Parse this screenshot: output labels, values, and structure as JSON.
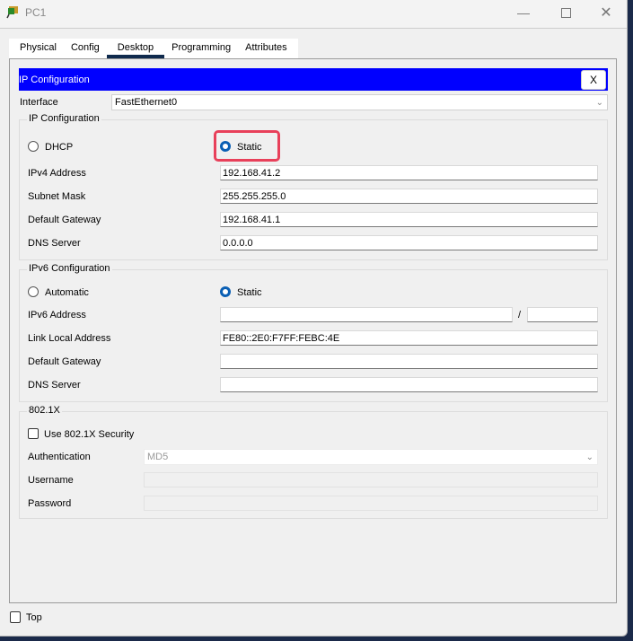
{
  "window": {
    "title": "PC1",
    "icon": "packet-tracer-pc-icon",
    "controls": [
      "minimize-icon",
      "maximize-icon",
      "close-icon"
    ]
  },
  "tabs": [
    {
      "label": "Physical",
      "active": false
    },
    {
      "label": "Config",
      "active": false
    },
    {
      "label": "Desktop",
      "active": true
    },
    {
      "label": "Programming",
      "active": false
    },
    {
      "label": "Attributes",
      "active": false
    }
  ],
  "ip_config": {
    "header": "IP Configuration",
    "close_label": "X",
    "interface_label": "Interface",
    "interface_value": "FastEthernet0",
    "ipv4": {
      "legend": "IP Configuration",
      "dhcp_label": "DHCP",
      "static_label": "Static",
      "selected": "Static",
      "fields": [
        {
          "label": "IPv4 Address",
          "value": "192.168.41.2"
        },
        {
          "label": "Subnet Mask",
          "value": "255.255.255.0"
        },
        {
          "label": "Default Gateway",
          "value": "192.168.41.1"
        },
        {
          "label": "DNS Server",
          "value": "0.0.0.0"
        }
      ]
    },
    "ipv6": {
      "legend": "IPv6 Configuration",
      "automatic_label": "Automatic",
      "static_label": "Static",
      "selected": "Static",
      "address_label": "IPv6 Address",
      "address_value": "",
      "prefix_separator": "/",
      "prefix_value": "",
      "link_local_label": "Link Local Address",
      "link_local_value": "FE80::2E0:F7FF:FEBC:4E",
      "gateway_label": "Default Gateway",
      "gateway_value": "",
      "dns_label": "DNS Server",
      "dns_value": ""
    },
    "dot1x": {
      "legend": "802.1X",
      "use_label": "Use 802.1X Security",
      "use_checked": false,
      "auth_label": "Authentication",
      "auth_value": "MD5",
      "username_label": "Username",
      "username_value": "",
      "password_label": "Password",
      "password_value": ""
    }
  },
  "footer": {
    "top_label": "Top",
    "top_checked": false
  },
  "colors": {
    "header_bar": "#0000ff",
    "radio_selected": "#0a5fb4",
    "highlight": "#e8405a",
    "active_tab_underline": "#0f2a4d"
  }
}
